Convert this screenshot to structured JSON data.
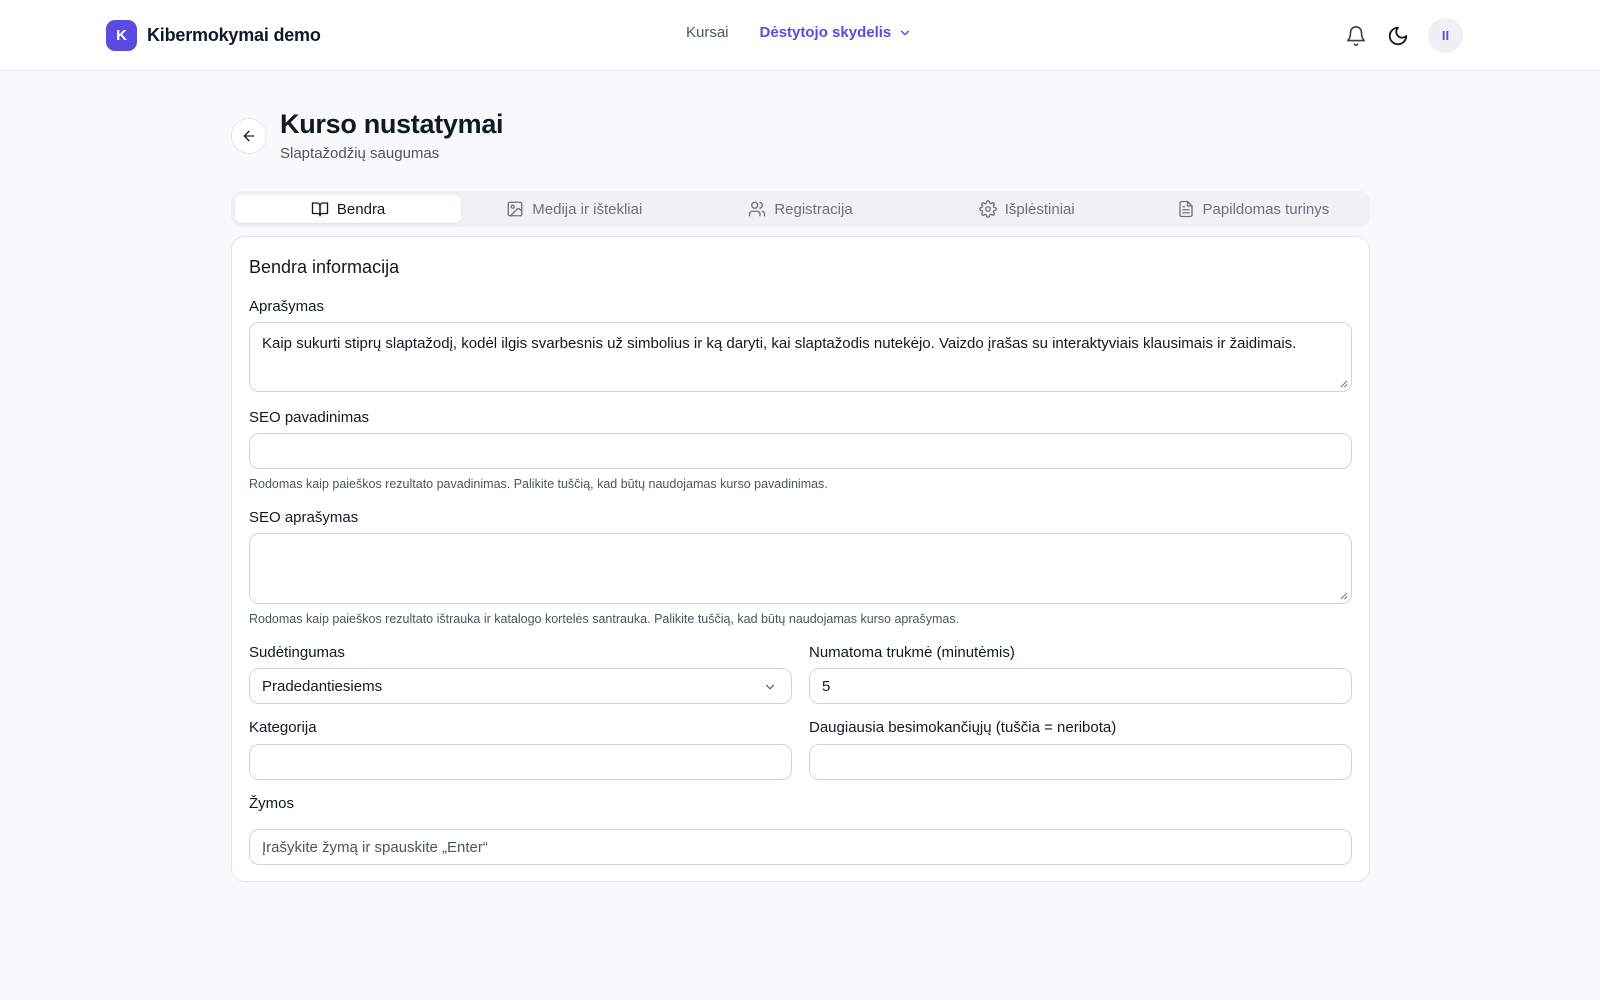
{
  "brand": {
    "logo_letter": "K",
    "name": "Kibermokymai demo",
    "color": "#5b4be0"
  },
  "nav": {
    "link_courses": "Kursai",
    "active_menu": "Dėstytojo skydelis"
  },
  "user": {
    "initials": "II"
  },
  "icons": {
    "notifications": "bell-icon",
    "theme": "moon-icon",
    "back": "arrow-left-icon"
  },
  "header": {
    "title": "Kurso nustatymai",
    "subtitle": "Slaptažodžių saugumas"
  },
  "tabs": [
    {
      "label": "Bendra",
      "icon": "book-open-icon",
      "active": true
    },
    {
      "label": "Medija ir ištekliai",
      "icon": "image-icon",
      "active": false
    },
    {
      "label": "Registracija",
      "icon": "users-icon",
      "active": false
    },
    {
      "label": "Išplėstiniai",
      "icon": "gear-icon",
      "active": false
    },
    {
      "label": "Papildomas turinys",
      "icon": "file-text-icon",
      "active": false
    }
  ],
  "form": {
    "section_title": "Bendra informacija",
    "description": {
      "label": "Aprašymas",
      "value": "Kaip sukurti stiprų slaptažodį, kodėl ilgis svarbesnis už simbolius ir ką daryti, kai slaptažodis nutekėjo. Vaizdo įrašas su interaktyviais klausimais ir žaidimais."
    },
    "seo_title": {
      "label": "SEO pavadinimas",
      "value": "",
      "help": "Rodomas kaip paieškos rezultato pavadinimas. Palikite tuščią, kad būtų naudojamas kurso pavadinimas."
    },
    "seo_description": {
      "label": "SEO aprašymas",
      "value": "",
      "help": "Rodomas kaip paieškos rezultato ištrauka ir katalogo kortelės santrauka. Palikite tuščią, kad būtų naudojamas kurso aprašymas."
    },
    "difficulty": {
      "label": "Sudėtingumas",
      "value": "Pradedantiesiems"
    },
    "duration": {
      "label": "Numatoma trukmė (minutėmis)",
      "value": "5"
    },
    "category": {
      "label": "Kategorija",
      "value": ""
    },
    "max_students": {
      "label": "Daugiausia besimokančiųjų (tuščia = neribota)",
      "value": ""
    },
    "tags": {
      "label": "Žymos",
      "placeholder": "Įrašykite žymą ir spauskite „Enter“"
    }
  }
}
